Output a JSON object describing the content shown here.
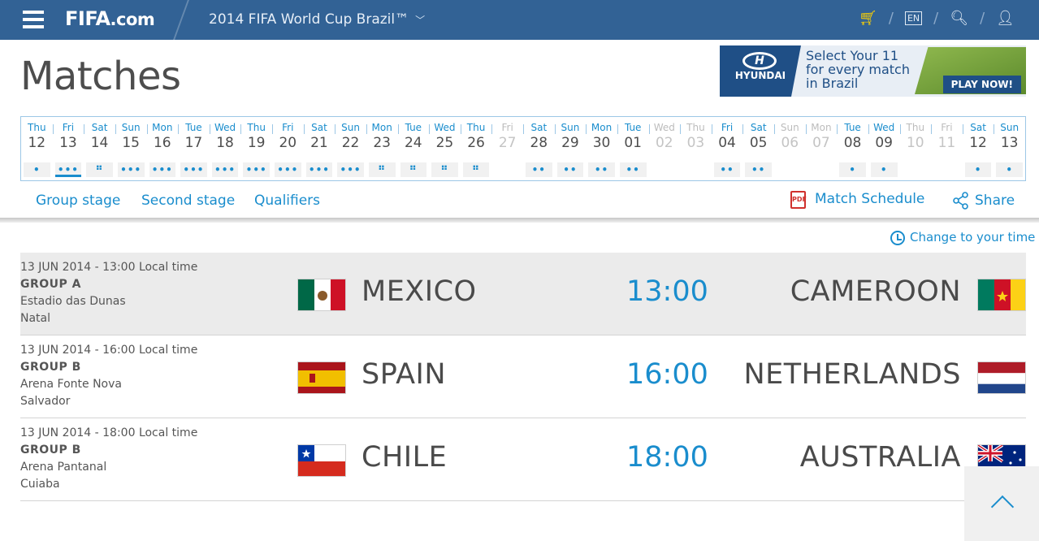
{
  "header": {
    "logo_text": "FIFA",
    "logo_suffix": ".com",
    "tournament": "2014 FIFA World Cup Brazil™",
    "language": "EN",
    "separator": "/"
  },
  "page": {
    "title": "Matches"
  },
  "ad": {
    "brand": "HYUNDAI",
    "line1": "Select Your 11",
    "line2": "for every match",
    "line3": "in Brazil",
    "cta": "PLAY NOW!"
  },
  "dates": [
    {
      "dow": "Thu",
      "day": "12",
      "dots": "•",
      "dim": false,
      "selected": false
    },
    {
      "dow": "Fri",
      "day": "13",
      "dots": "•••",
      "dim": false,
      "selected": true
    },
    {
      "dow": "Sat",
      "day": "14",
      "dots": "⠛",
      "dim": false,
      "selected": false
    },
    {
      "dow": "Sun",
      "day": "15",
      "dots": "•••",
      "dim": false,
      "selected": false
    },
    {
      "dow": "Mon",
      "day": "16",
      "dots": "•••",
      "dim": false,
      "selected": false
    },
    {
      "dow": "Tue",
      "day": "17",
      "dots": "•••",
      "dim": false,
      "selected": false
    },
    {
      "dow": "Wed",
      "day": "18",
      "dots": "•••",
      "dim": false,
      "selected": false
    },
    {
      "dow": "Thu",
      "day": "19",
      "dots": "•••",
      "dim": false,
      "selected": false
    },
    {
      "dow": "Fri",
      "day": "20",
      "dots": "•••",
      "dim": false,
      "selected": false
    },
    {
      "dow": "Sat",
      "day": "21",
      "dots": "•••",
      "dim": false,
      "selected": false
    },
    {
      "dow": "Sun",
      "day": "22",
      "dots": "•••",
      "dim": false,
      "selected": false
    },
    {
      "dow": "Mon",
      "day": "23",
      "dots": "⠛",
      "dim": false,
      "selected": false
    },
    {
      "dow": "Tue",
      "day": "24",
      "dots": "⠛",
      "dim": false,
      "selected": false
    },
    {
      "dow": "Wed",
      "day": "25",
      "dots": "⠛",
      "dim": false,
      "selected": false
    },
    {
      "dow": "Thu",
      "day": "26",
      "dots": "⠛",
      "dim": false,
      "selected": false
    },
    {
      "dow": "Fri",
      "day": "27",
      "dots": "",
      "dim": true,
      "selected": false
    },
    {
      "dow": "Sat",
      "day": "28",
      "dots": "••",
      "dim": false,
      "selected": false
    },
    {
      "dow": "Sun",
      "day": "29",
      "dots": "••",
      "dim": false,
      "selected": false
    },
    {
      "dow": "Mon",
      "day": "30",
      "dots": "••",
      "dim": false,
      "selected": false
    },
    {
      "dow": "Tue",
      "day": "01",
      "dots": "••",
      "dim": false,
      "selected": false
    },
    {
      "dow": "Wed",
      "day": "02",
      "dots": "",
      "dim": true,
      "selected": false
    },
    {
      "dow": "Thu",
      "day": "03",
      "dots": "",
      "dim": true,
      "selected": false
    },
    {
      "dow": "Fri",
      "day": "04",
      "dots": "••",
      "dim": false,
      "selected": false
    },
    {
      "dow": "Sat",
      "day": "05",
      "dots": "••",
      "dim": false,
      "selected": false
    },
    {
      "dow": "Sun",
      "day": "06",
      "dots": "",
      "dim": true,
      "selected": false
    },
    {
      "dow": "Mon",
      "day": "07",
      "dots": "",
      "dim": true,
      "selected": false
    },
    {
      "dow": "Tue",
      "day": "08",
      "dots": "•",
      "dim": false,
      "selected": false
    },
    {
      "dow": "Wed",
      "day": "09",
      "dots": "•",
      "dim": false,
      "selected": false
    },
    {
      "dow": "Thu",
      "day": "10",
      "dots": "",
      "dim": true,
      "selected": false
    },
    {
      "dow": "Fri",
      "day": "11",
      "dots": "",
      "dim": true,
      "selected": false
    },
    {
      "dow": "Sat",
      "day": "12",
      "dots": "•",
      "dim": false,
      "selected": false
    },
    {
      "dow": "Sun",
      "day": "13",
      "dots": "•",
      "dim": false,
      "selected": false
    }
  ],
  "subnav": {
    "group_stage": "Group stage",
    "second_stage": "Second stage",
    "qualifiers": "Qualifiers",
    "match_schedule": "Match Schedule",
    "share": "Share",
    "pdf_icon_label": "PDF"
  },
  "change_time": "Change to your time",
  "matches": [
    {
      "datetime": "13 JUN 2014 - 13:00 Local time",
      "group": "GROUP A",
      "stadium": "Estadio das Dunas",
      "city": "Natal",
      "home": "MEXICO",
      "time": "13:00",
      "away": "CAMEROON",
      "home_flag": "mexico",
      "away_flag": "cameroon"
    },
    {
      "datetime": "13 JUN 2014 - 16:00 Local time",
      "group": "GROUP B",
      "stadium": "Arena Fonte Nova",
      "city": "Salvador",
      "home": "SPAIN",
      "time": "16:00",
      "away": "NETHERLANDS",
      "home_flag": "spain",
      "away_flag": "netherlands"
    },
    {
      "datetime": "13 JUN 2014 - 18:00 Local time",
      "group": "GROUP B",
      "stadium": "Arena Pantanal",
      "city": "Cuiaba",
      "home": "CHILE",
      "time": "18:00",
      "away": "AUSTRALIA",
      "home_flag": "chile",
      "away_flag": "australia"
    }
  ],
  "colors": {
    "header_bg": "#326295",
    "accent": "#1a8dcd",
    "text": "#4a4a4a",
    "row_shaded": "#ebebeb"
  }
}
